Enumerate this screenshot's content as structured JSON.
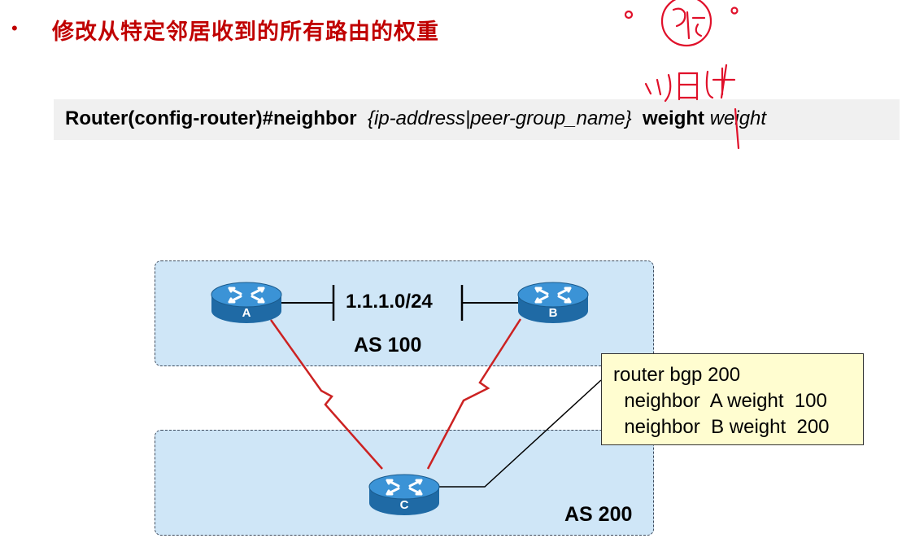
{
  "slide": {
    "bullet": "•",
    "title": "修改从特定邻居收到的所有路由的权重"
  },
  "command": {
    "prefix": "Router(config-router)#neighbor",
    "args": "{ip-address|peer-group_name}",
    "keyword": "weight",
    "param": "weight"
  },
  "diagram": {
    "network": "1.1.1.0/24",
    "as_top": "AS 100",
    "as_bottom": "AS 200",
    "routers": [
      {
        "label": "A"
      },
      {
        "label": "B"
      },
      {
        "label": "C"
      }
    ],
    "config": [
      "router bgp 200",
      "  neighbor  A weight  100",
      "  neighbor  B weight  200"
    ]
  },
  "colors": {
    "title": "#c00000",
    "as_fill": "#cfe6f7",
    "link": "#cc2222",
    "router": "#2f86c5",
    "callout": "#fffdd0",
    "ink": "#e0102a"
  }
}
